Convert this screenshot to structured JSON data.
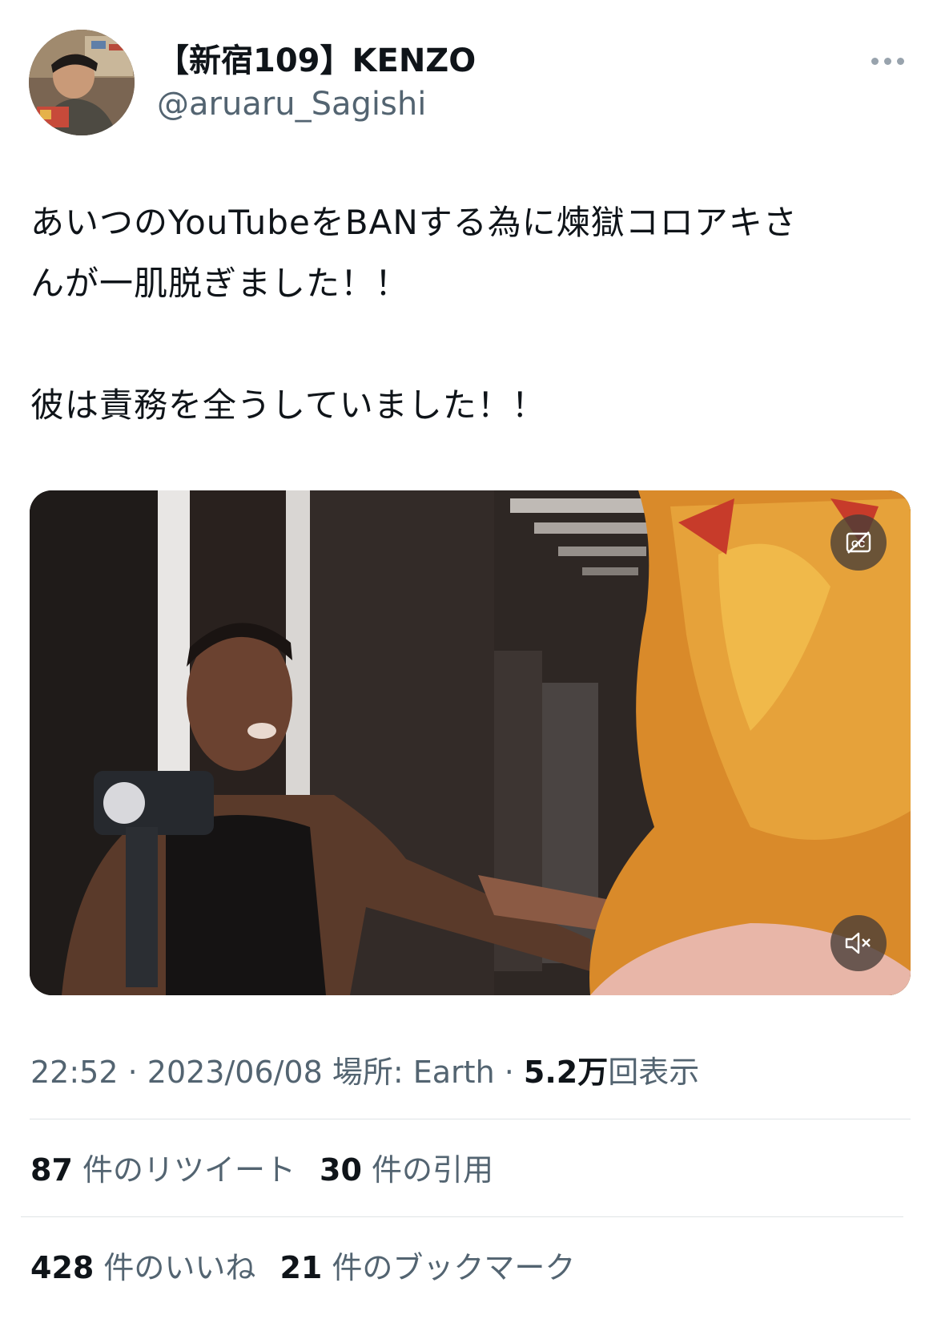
{
  "author": {
    "display_name": "【新宿109】KENZO",
    "username": "@aruaru_Sagishi",
    "avatar_icon": "user-avatar-photo"
  },
  "tweet": {
    "text_line1": "あいつのYouTubeをBANする為に煉獄コロアキさ",
    "text_line2": "んが一肌脱ぎました！！",
    "text_line3": "彼は責務を全うしていました！！"
  },
  "media": {
    "captions_icon": "captions-off-icon",
    "mute_icon": "muted-speaker-icon"
  },
  "meta": {
    "time": "22:52",
    "sep1": " · ",
    "date": "2023/06/08",
    "location_label": " 場所: ",
    "location": "Earth",
    "sep2": " · ",
    "views_count": "5.2万",
    "views_label": "回表示"
  },
  "stats": {
    "retweets_count": "87",
    "retweets_label": "件のリツイート",
    "quotes_count": "30",
    "quotes_label": "件の引用",
    "likes_count": "428",
    "likes_label": "件のいいね",
    "bookmarks_count": "21",
    "bookmarks_label": "件のブックマーク"
  }
}
